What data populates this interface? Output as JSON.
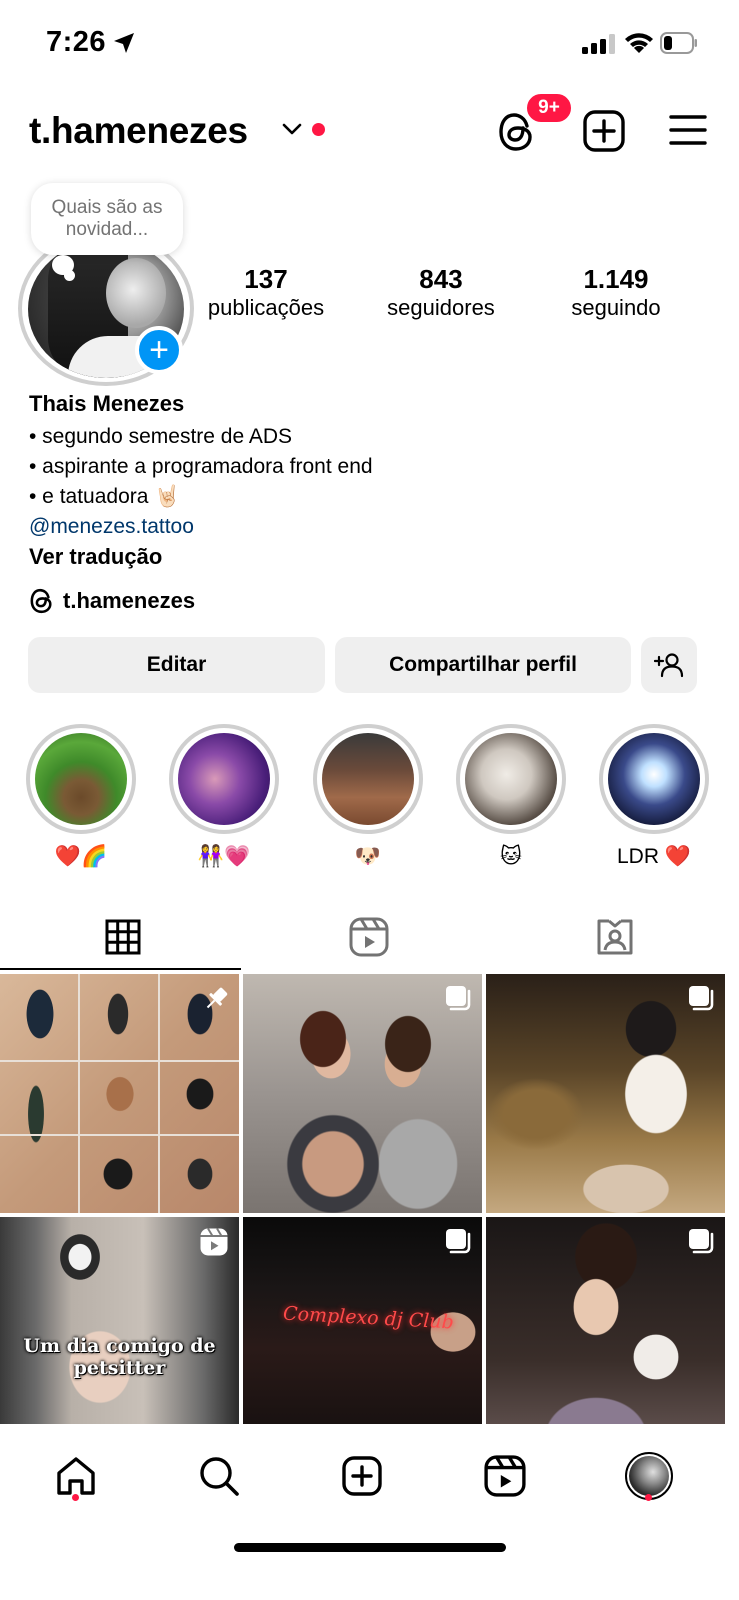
{
  "status_bar": {
    "time": "7:26"
  },
  "header": {
    "username": "t.hamenezes",
    "threads_badge": "9+"
  },
  "note": {
    "text": "Quais são as novidad..."
  },
  "stats": [
    {
      "value": "137",
      "label": "publicações"
    },
    {
      "value": "843",
      "label": "seguidores"
    },
    {
      "value": "1.149",
      "label": "seguindo"
    }
  ],
  "bio": {
    "name": "Thais Menezes",
    "lines": [
      "• segundo semestre de ADS",
      "• aspirante a programadora front end",
      "• e tatuadora 🤘🏻"
    ],
    "link": "@menezes.tattoo",
    "translate": "Ver tradução",
    "threads_handle": "t.hamenezes"
  },
  "buttons": {
    "edit": "Editar",
    "share": "Compartilhar perfil"
  },
  "highlights": [
    {
      "label": "❤️🌈"
    },
    {
      "label": "👭💗"
    },
    {
      "label": "🐶"
    },
    {
      "label": "🐱"
    },
    {
      "label": "LDR ❤️"
    }
  ],
  "tabs": [
    "grid-icon",
    "reels-icon",
    "tagged-icon"
  ],
  "posts": [
    {
      "type": "pinned"
    },
    {
      "type": "carousel"
    },
    {
      "type": "carousel"
    },
    {
      "type": "reel",
      "caption": "Um dia comigo de petsitter"
    },
    {
      "type": "carousel",
      "sign_text": "Complexo dj Club"
    },
    {
      "type": "carousel"
    }
  ],
  "nav": [
    "home-icon",
    "search-icon",
    "create-icon",
    "reels-icon",
    "profile-avatar"
  ],
  "colors": {
    "accent_blue": "#0095f6",
    "notification_red": "#ff1744",
    "link": "#00376b",
    "button_bg": "#efefef"
  }
}
